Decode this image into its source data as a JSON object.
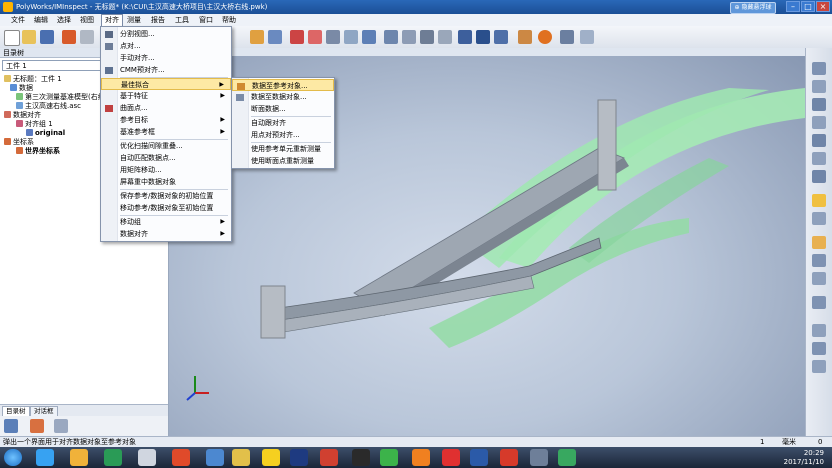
{
  "window": {
    "title": "PolyWorks/IMInspect - 无标题* (K:\\CUI\\主汉高速大桥项目\\主汉大桥右线.pwk)",
    "hud_label": "⊕ 隐藏悬浮球"
  },
  "menubar": [
    "文件",
    "编辑",
    "选择",
    "视图",
    "对齐",
    "测量",
    "报告",
    "工具",
    "窗口",
    "帮助"
  ],
  "active_menu": "对齐",
  "left_panel": {
    "title": "目录树",
    "selector_value": "工件 1",
    "tree": [
      {
        "label": "无标题：工件 1",
        "bold": false
      },
      {
        "label": "数据",
        "bold": false
      },
      {
        "label": "第三次测量基准模型(右线)",
        "bold": false
      },
      {
        "label": "主汉高速右线.asc",
        "bold": false
      },
      {
        "label": "数据对齐",
        "bold": false
      },
      {
        "label": "对齐组 1",
        "bold": false
      },
      {
        "label": "original",
        "bold": true
      },
      {
        "label": "坐标系",
        "bold": false
      },
      {
        "label": "世界坐标系",
        "bold": true
      }
    ],
    "tabs": [
      "目录树",
      "对话框"
    ]
  },
  "align_menu": {
    "items": [
      {
        "label": "分割视图...",
        "submenu": false,
        "icon": true
      },
      {
        "label": "点对...",
        "submenu": false,
        "icon": true
      },
      {
        "label": "手动对齐...",
        "submenu": false,
        "icon": false
      },
      {
        "label": "CMM预对齐...",
        "submenu": false,
        "icon": true
      },
      {
        "label": "最佳拟合",
        "submenu": true,
        "icon": false,
        "highlight": true
      },
      {
        "label": "基于特征",
        "submenu": true,
        "icon": false
      },
      {
        "label": "曲面点...",
        "submenu": false,
        "icon": true
      },
      {
        "label": "参考目标",
        "submenu": true,
        "icon": false
      },
      {
        "label": "基准参考框",
        "submenu": true,
        "icon": false
      },
      {
        "label": "优化扫描间隙重叠...",
        "submenu": false,
        "icon": false
      },
      {
        "label": "自动匹配数据点...",
        "submenu": false,
        "icon": false
      },
      {
        "label": "用矩阵移动...",
        "submenu": false,
        "icon": false
      },
      {
        "label": "屏幕重中数据对象",
        "submenu": false,
        "icon": false
      },
      {
        "label": "保存参考/数据对象的初始位置",
        "submenu": false,
        "icon": false
      },
      {
        "label": "移动参考/数据对象至初始位置",
        "submenu": false,
        "icon": false
      },
      {
        "label": "移动组",
        "submenu": true,
        "icon": false
      },
      {
        "label": "数据对齐",
        "submenu": true,
        "icon": false
      }
    ]
  },
  "bestfit_submenu": {
    "items": [
      {
        "label": "数据至参考对象...",
        "icon": true,
        "highlight": true
      },
      {
        "label": "数据至数据对象...",
        "icon": true
      },
      {
        "label": "断面数据...",
        "icon": false
      },
      {
        "label": "自动跟对齐",
        "icon": false
      },
      {
        "label": "用点对预对齐...",
        "icon": false
      },
      {
        "label": "使用参考单元重新测量",
        "icon": false
      },
      {
        "label": "使用断面点重新测量",
        "icon": false
      }
    ]
  },
  "statusbar": {
    "message": "弹出一个界面用于对齐数据对象至参考对象",
    "zoom": "1",
    "unit_label": "毫米",
    "value": "0"
  },
  "taskbar": {
    "time": "20:29",
    "date": "2017/11/10"
  },
  "colors": {
    "title_bar": "#1b4f96",
    "bridge_green": "#9fe8b0",
    "bridge_steel": "#8e98a4",
    "menu_highlight": "#fde9a4"
  }
}
